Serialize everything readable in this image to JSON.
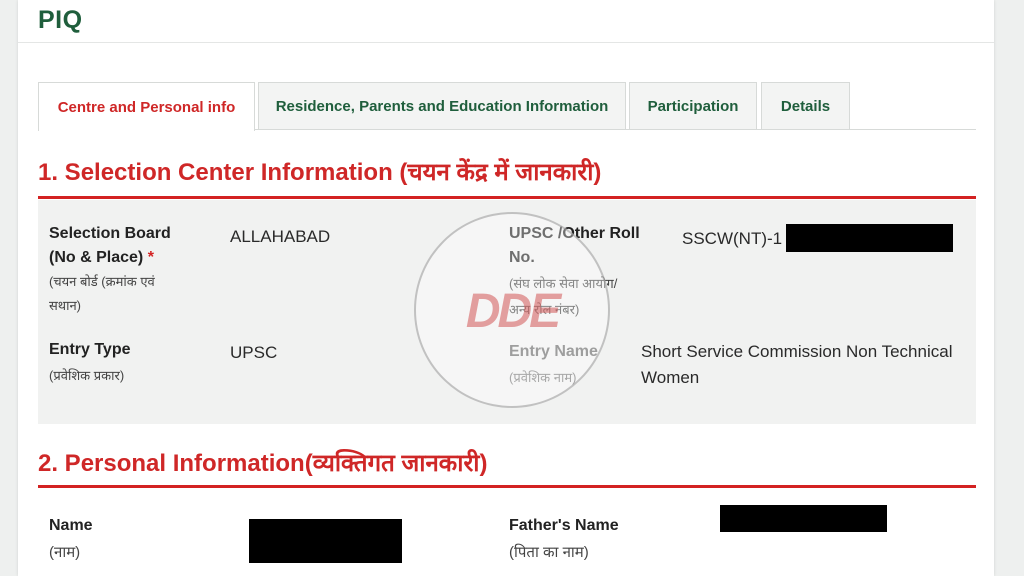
{
  "page": {
    "title": "PIQ"
  },
  "tabs": [
    {
      "label": "Centre and Personal info",
      "active": true
    },
    {
      "label": "Residence, Parents and Education Information",
      "active": false
    },
    {
      "label": "Participation",
      "active": false
    },
    {
      "label": "Details",
      "active": false
    }
  ],
  "sections": {
    "selection_center": {
      "title": "1. Selection Center Information (चयन केंद्र में जानकारी)",
      "selection_board": {
        "label_line1": "Selection Board",
        "label_line2": "(No & Place)",
        "required_mark": "*",
        "hindi_line1": "(चयन बोर्ड (क्रमांक एवं",
        "hindi_line2": "सथान)",
        "value": "ALLAHABAD"
      },
      "roll_no": {
        "label_line1": "UPSC /Other Roll",
        "label_line2": "No.",
        "hindi_line1": "(संघ लोक सेवा आयोग/",
        "hindi_line2": "अन्य रोल नंबर)",
        "value_prefix": "SSCW(NT)-1"
      },
      "entry_type": {
        "label": "Entry Type",
        "hindi": "(प्रवेशिक प्रकार)",
        "value": "UPSC"
      },
      "entry_name": {
        "label": "Entry Name",
        "hindi": "(प्रवेशिक नाम)",
        "value_line1": "Short Service Commission Non Technical",
        "value_line2": "Women"
      }
    },
    "personal": {
      "title": "2. Personal Information(व्यक्तिगत जानकारी)",
      "name": {
        "label": "Name",
        "hindi": "(नाम)"
      },
      "father_name": {
        "label": "Father's Name",
        "hindi": "(पिता का नाम)"
      }
    }
  },
  "watermark": {
    "text": "DDE"
  }
}
